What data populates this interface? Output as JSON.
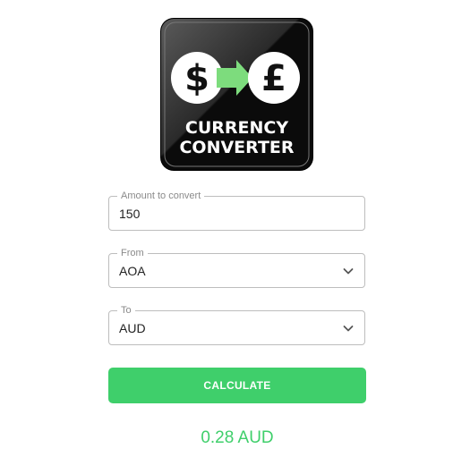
{
  "logo": {
    "icon": "currency-converter-logo",
    "from_symbol": "$",
    "to_symbol": "£",
    "line1": "CURRENCY",
    "line2": "CONVERTER",
    "arrow_color": "#7ddc7d"
  },
  "form": {
    "amount": {
      "label": "Amount to convert",
      "value": "150"
    },
    "from": {
      "label": "From",
      "value": "AOA"
    },
    "to": {
      "label": "To",
      "value": "AUD"
    },
    "calculate_label": "CALCULATE"
  },
  "result": {
    "text": "0.28 AUD"
  },
  "colors": {
    "accent": "#3fcf6b",
    "border": "#bdbdbd",
    "label": "#8a8a8a"
  }
}
